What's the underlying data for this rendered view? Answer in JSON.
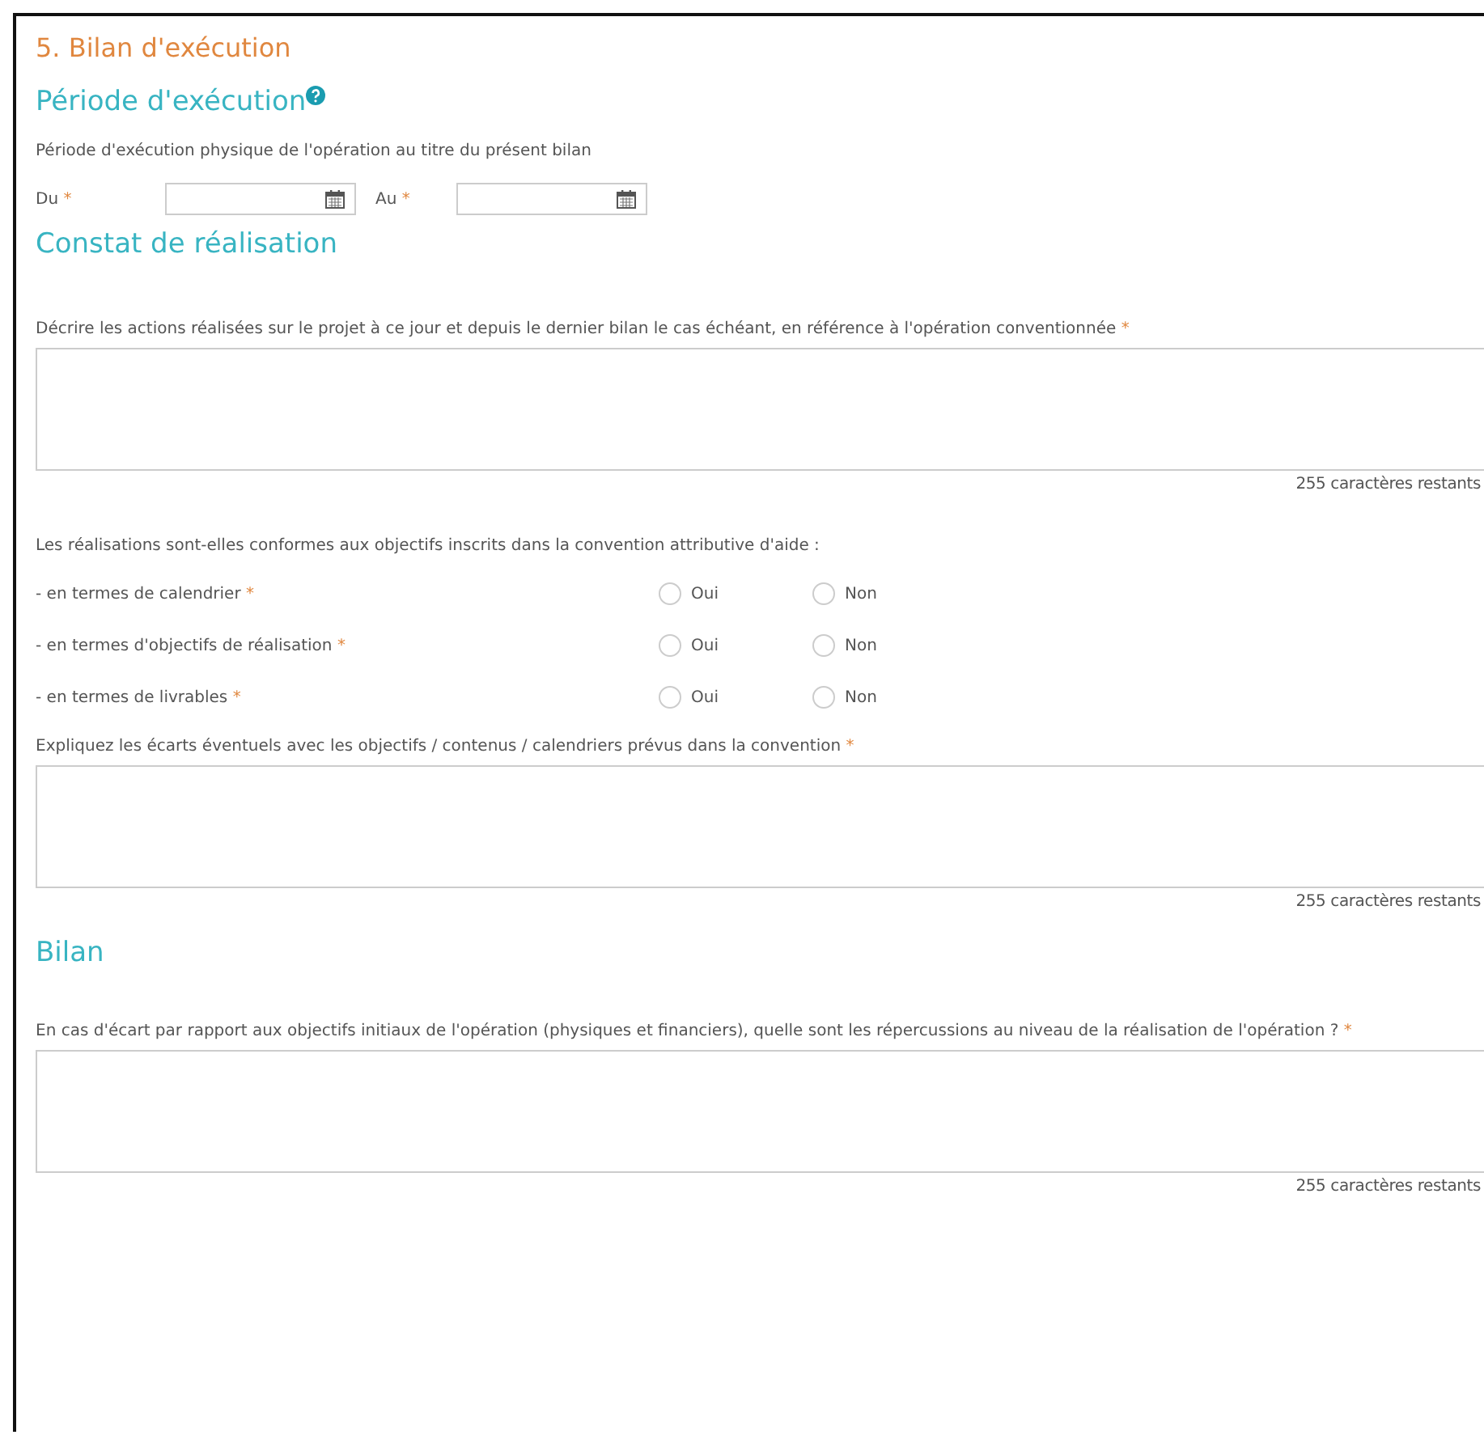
{
  "section_title": "5. Bilan d'exécution",
  "period": {
    "heading": "Période d'exécution",
    "description": "Période d'exécution physique de l'opération au titre du présent bilan",
    "fields": [
      {
        "label": "Du",
        "required": "*"
      },
      {
        "label": "Au",
        "required": "*"
      }
    ]
  },
  "constat": {
    "heading": "Constat de réalisation",
    "actions": {
      "label": "Décrire les actions réalisées sur le projet à ce jour et depuis le dernier bilan le cas échéant, en référence à l'opération conventionnée",
      "required": "*",
      "counter": "255 caractères restants"
    },
    "question": "Les réalisations sont-elles conformes aux objectifs inscrits dans la convention attributive d'aide :",
    "criteria": [
      {
        "label": "- en termes de calendrier",
        "required": "*",
        "options": [
          {
            "label": "Oui",
            "selected": false
          },
          {
            "label": "Non",
            "selected": false
          }
        ]
      },
      {
        "label": "- en termes d'objectifs de réalisation",
        "required": "*",
        "options": [
          {
            "label": "Oui",
            "selected": false
          },
          {
            "label": "Non",
            "selected": false
          }
        ]
      },
      {
        "label": "- en termes de livrables",
        "required": "*",
        "options": [
          {
            "label": "Oui",
            "selected": false
          },
          {
            "label": "Non",
            "selected": false
          }
        ]
      }
    ],
    "gaps": {
      "label": "Expliquez les écarts éventuels avec les objectifs / contenus / calendriers prévus dans la convention",
      "required": "*",
      "counter": "255 caractères restants"
    }
  },
  "bilan": {
    "heading": "Bilan",
    "impact": {
      "label": "En cas d'écart par rapport aux objectifs initiaux de l'opération (physiques et financiers), quelle sont les répercussions au niveau de la réalisation de l'opération ?",
      "required": "*",
      "counter": "255 caractères restants"
    }
  }
}
